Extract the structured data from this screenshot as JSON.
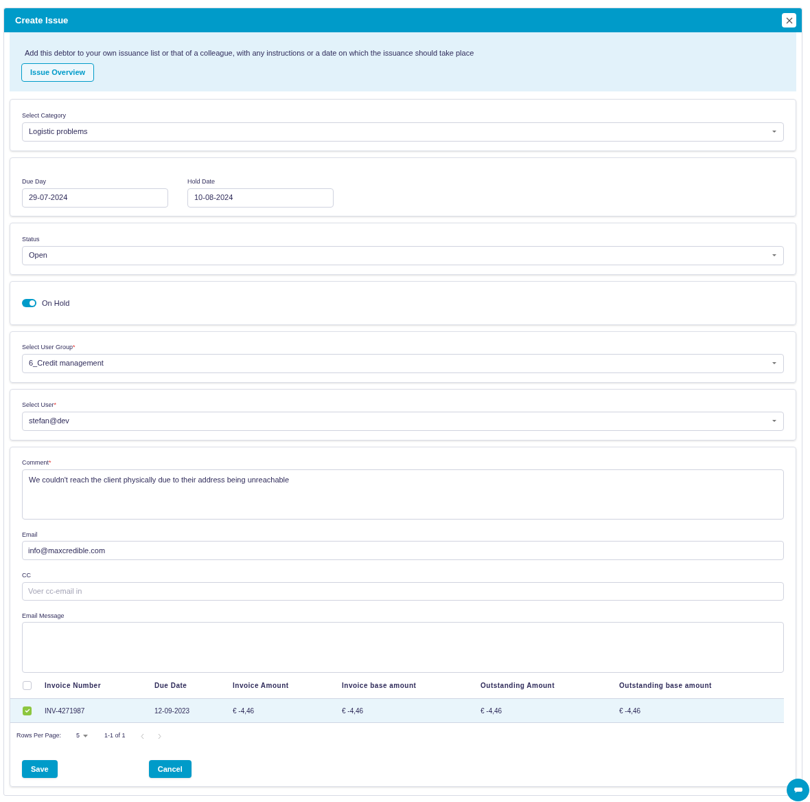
{
  "dialog": {
    "title": "Create Issue"
  },
  "info": {
    "text": "Add this debtor to your own issuance list or that of a colleague, with any instructions or a date on which the issuance should take place",
    "button": "Issue Overview"
  },
  "category": {
    "label": "Select Category",
    "value": "Logistic problems"
  },
  "dates": [
    {
      "label": "Due Day",
      "value": "29-07-2024"
    },
    {
      "label": "Hold Date",
      "value": "10-08-2024"
    }
  ],
  "status": {
    "label": "Status",
    "value": "Open"
  },
  "on_hold": {
    "label": "On Hold",
    "on": true
  },
  "user_group": {
    "label": "Select User Group",
    "required_mark": "*",
    "value": "6_Credit management"
  },
  "user": {
    "label": "Select User",
    "required_mark": "*",
    "value": "stefan@dev"
  },
  "comment": {
    "label": "Comment",
    "required_mark": "*",
    "value": "We couldn't reach the client physically due to their address being unreachable"
  },
  "email": {
    "label": "Email",
    "value": "info@maxcredible.com"
  },
  "cc": {
    "label": "CC",
    "placeholder": "Voer cc-email in"
  },
  "email_message": {
    "label": "Email Message"
  },
  "table": {
    "all_checked": false,
    "columns": [
      "Invoice Number",
      "Due Date",
      "Invoice Amount",
      "Invoice base amount",
      "Outstanding Amount",
      "Outstanding base amount"
    ],
    "rows": [
      {
        "checked": true,
        "cells": [
          "INV-4271987",
          "12-09-2023",
          "€ -4,46",
          "€ -4,46",
          "€ -4,46",
          "€ -4,46"
        ]
      }
    ]
  },
  "pagination": {
    "label": "Rows Per Page:",
    "rows_per_page": "5",
    "range": "1-1 of 1"
  },
  "buttons": [
    "Save",
    "Cancel"
  ]
}
